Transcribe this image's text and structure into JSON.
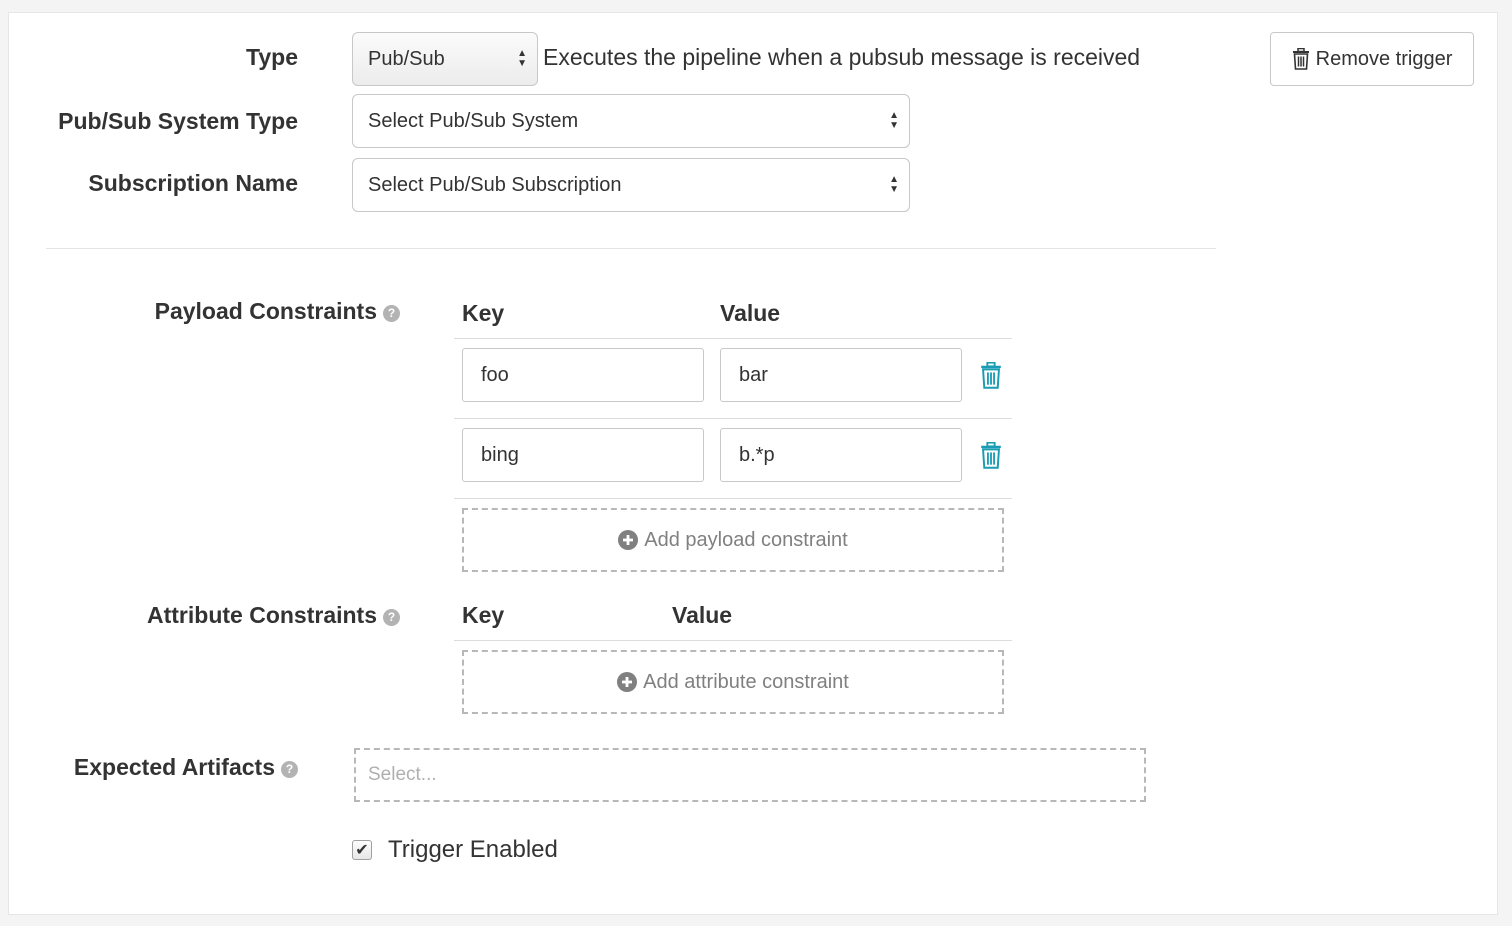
{
  "trigger": {
    "type_label": "Type",
    "type_value": "Pub/Sub",
    "type_description": "Executes the pipeline when a pubsub message is received",
    "remove_button_label": "Remove trigger",
    "system_type_label": "Pub/Sub System Type",
    "system_type_value": "Select Pub/Sub System",
    "subscription_label": "Subscription Name",
    "subscription_value": "Select Pub/Sub Subscription"
  },
  "payload_constraints": {
    "label": "Payload Constraints",
    "key_header": "Key",
    "value_header": "Value",
    "rows": [
      {
        "key": "foo",
        "value": "bar"
      },
      {
        "key": "bing",
        "value": "b.*p"
      }
    ],
    "add_label": "Add payload constraint"
  },
  "attribute_constraints": {
    "label": "Attribute Constraints",
    "key_header": "Key",
    "value_header": "Value",
    "add_label": "Add attribute constraint"
  },
  "expected_artifacts": {
    "label": "Expected Artifacts",
    "placeholder": "Select..."
  },
  "trigger_enabled": {
    "label": "Trigger Enabled",
    "checked": true
  },
  "icons": {
    "trash": "trash-icon",
    "help": "question-circle-icon",
    "add": "plus-circle-icon",
    "check": "checkmark-icon"
  },
  "colors": {
    "accent": "#1a9cb3",
    "muted_text": "#808080"
  }
}
